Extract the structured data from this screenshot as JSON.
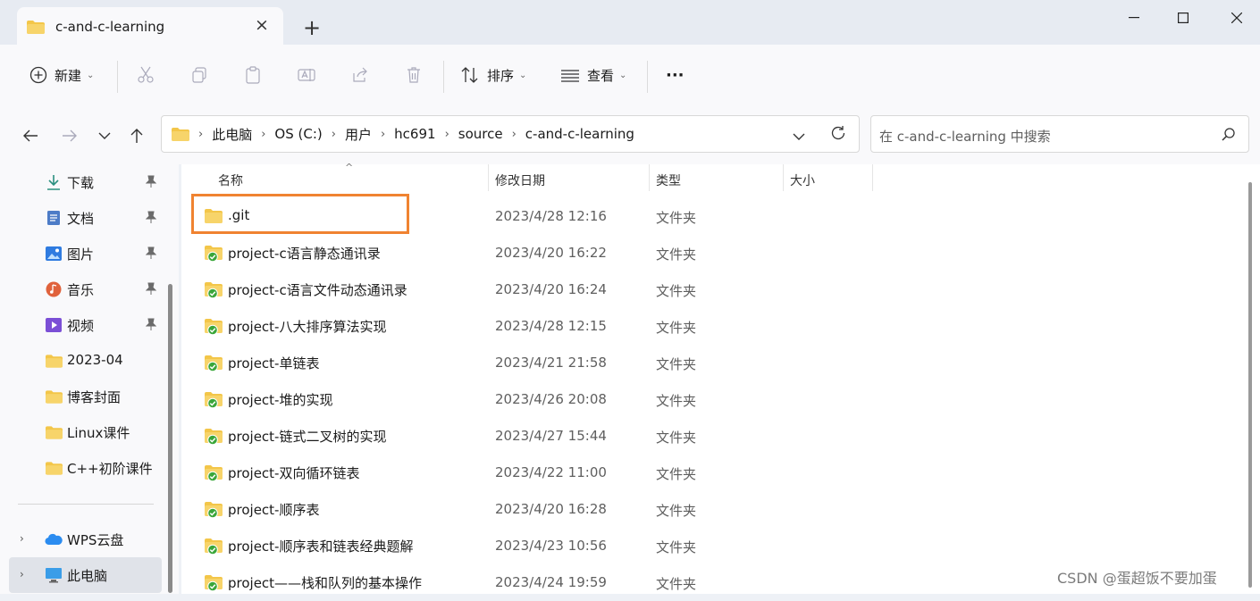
{
  "window": {
    "tab_title": "c-and-c-learning",
    "new_tab_symbol": "+",
    "close_symbol": "×"
  },
  "toolbar": {
    "new_label": "新建",
    "sort_label": "排序",
    "view_label": "查看",
    "more_label": "···"
  },
  "address": {
    "crumbs": [
      "此电脑",
      "OS (C:)",
      "用户",
      "hc691",
      "source",
      "c-and-c-learning"
    ]
  },
  "search": {
    "placeholder": "在 c-and-c-learning 中搜索"
  },
  "sidebar": {
    "items": [
      {
        "label": "下载",
        "icon": "download-icon",
        "pinned": true
      },
      {
        "label": "文档",
        "icon": "document-icon",
        "pinned": true
      },
      {
        "label": "图片",
        "icon": "pictures-icon",
        "pinned": true
      },
      {
        "label": "音乐",
        "icon": "music-icon",
        "pinned": true
      },
      {
        "label": "视频",
        "icon": "video-icon",
        "pinned": true
      },
      {
        "label": "2023-04",
        "icon": "folder-icon",
        "pinned": false
      },
      {
        "label": "博客封面",
        "icon": "folder-icon",
        "pinned": false
      },
      {
        "label": "Linux课件",
        "icon": "folder-icon",
        "pinned": false
      },
      {
        "label": "C++初阶课件",
        "icon": "folder-icon",
        "pinned": false
      }
    ],
    "wps": "WPS云盘",
    "thispc": "此电脑"
  },
  "columns": {
    "name": "名称",
    "date": "修改日期",
    "type": "类型",
    "size": "大小"
  },
  "files": [
    {
      "name": ".git",
      "date": "2023/4/28 12:16",
      "type": "文件夹",
      "synced": false
    },
    {
      "name": "project-c语言静态通讯录",
      "date": "2023/4/20 16:22",
      "type": "文件夹",
      "synced": true
    },
    {
      "name": "project-c语言文件动态通讯录",
      "date": "2023/4/20 16:24",
      "type": "文件夹",
      "synced": true
    },
    {
      "name": "project-八大排序算法实现",
      "date": "2023/4/28 12:15",
      "type": "文件夹",
      "synced": true
    },
    {
      "name": "project-单链表",
      "date": "2023/4/21 21:58",
      "type": "文件夹",
      "synced": true
    },
    {
      "name": "project-堆的实现",
      "date": "2023/4/26 20:08",
      "type": "文件夹",
      "synced": true
    },
    {
      "name": "project-链式二叉树的实现",
      "date": "2023/4/27 15:44",
      "type": "文件夹",
      "synced": true
    },
    {
      "name": "project-双向循环链表",
      "date": "2023/4/22 11:00",
      "type": "文件夹",
      "synced": true
    },
    {
      "name": "project-顺序表",
      "date": "2023/4/20 16:28",
      "type": "文件夹",
      "synced": true
    },
    {
      "name": "project-顺序表和链表经典题解",
      "date": "2023/4/23 10:56",
      "type": "文件夹",
      "synced": true
    },
    {
      "name": "project——栈和队列的基本操作",
      "date": "2023/4/24 19:59",
      "type": "文件夹",
      "synced": true
    }
  ],
  "watermark": "CSDN @蛋超饭不要加蛋",
  "colors": {
    "highlight": "#f08331",
    "folder": "#f3c649",
    "sync_green": "#3aa63a"
  }
}
